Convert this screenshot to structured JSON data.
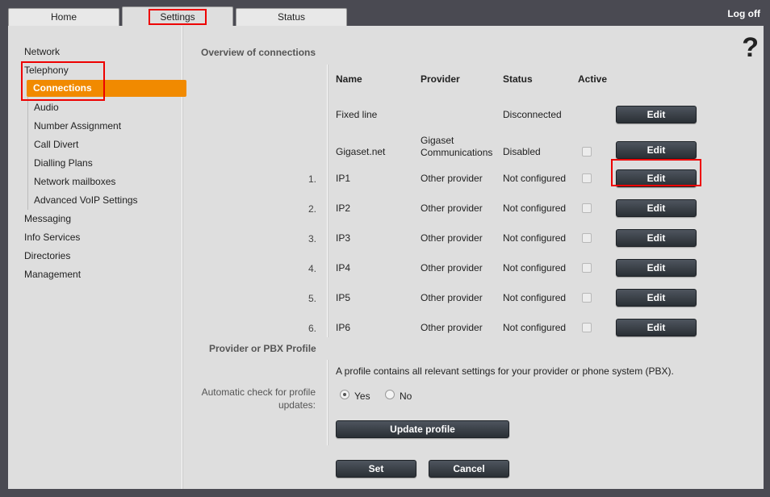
{
  "tabs": [
    {
      "label": "Home"
    },
    {
      "label": "Settings"
    },
    {
      "label": "Status"
    }
  ],
  "logoff": "Log off",
  "help": "?",
  "sidebar": {
    "items": [
      {
        "label": "Network"
      },
      {
        "label": "Telephony"
      },
      {
        "label": "Messaging"
      },
      {
        "label": "Info Services"
      },
      {
        "label": "Directories"
      },
      {
        "label": "Management"
      }
    ],
    "telephony_sub": [
      {
        "label": "Connections"
      },
      {
        "label": "Audio"
      },
      {
        "label": "Number Assignment"
      },
      {
        "label": "Call Divert"
      },
      {
        "label": "Dialling Plans"
      },
      {
        "label": "Network mailboxes"
      },
      {
        "label": "Advanced VoIP Settings"
      }
    ]
  },
  "overview": {
    "title": "Overview of connections",
    "headers": {
      "name": "Name",
      "provider": "Provider",
      "status": "Status",
      "active": "Active"
    },
    "rows": [
      {
        "num": "",
        "name": "Fixed line",
        "provider": "",
        "provider2": "",
        "status": "Disconnected",
        "has_checkbox": false,
        "edit": "Edit"
      },
      {
        "num": "",
        "name": "Gigaset.net",
        "provider": "Gigaset",
        "provider2": "Communications",
        "status": "Disabled",
        "has_checkbox": true,
        "edit": "Edit"
      },
      {
        "num": "1.",
        "name": "IP1",
        "provider": "Other provider",
        "provider2": "",
        "status": "Not configured",
        "has_checkbox": true,
        "edit": "Edit"
      },
      {
        "num": "2.",
        "name": "IP2",
        "provider": "Other provider",
        "provider2": "",
        "status": "Not configured",
        "has_checkbox": true,
        "edit": "Edit"
      },
      {
        "num": "3.",
        "name": "IP3",
        "provider": "Other provider",
        "provider2": "",
        "status": "Not configured",
        "has_checkbox": true,
        "edit": "Edit"
      },
      {
        "num": "4.",
        "name": "IP4",
        "provider": "Other provider",
        "provider2": "",
        "status": "Not configured",
        "has_checkbox": true,
        "edit": "Edit"
      },
      {
        "num": "5.",
        "name": "IP5",
        "provider": "Other provider",
        "provider2": "",
        "status": "Not configured",
        "has_checkbox": true,
        "edit": "Edit"
      },
      {
        "num": "6.",
        "name": "IP6",
        "provider": "Other provider",
        "provider2": "",
        "status": "Not configured",
        "has_checkbox": true,
        "edit": "Edit"
      }
    ]
  },
  "profile": {
    "title": "Provider or PBX Profile",
    "description": "A profile contains all relevant settings for your provider or phone system (PBX).",
    "auto_check_label_1": "Automatic check for profile",
    "auto_check_label_2": "updates:",
    "yes": "Yes",
    "no": "No",
    "selected": "Yes",
    "update_button": "Update profile"
  },
  "footer": {
    "set": "Set",
    "cancel": "Cancel"
  },
  "colors": {
    "accent": "#f18a00",
    "highlight": "#ee0000"
  }
}
